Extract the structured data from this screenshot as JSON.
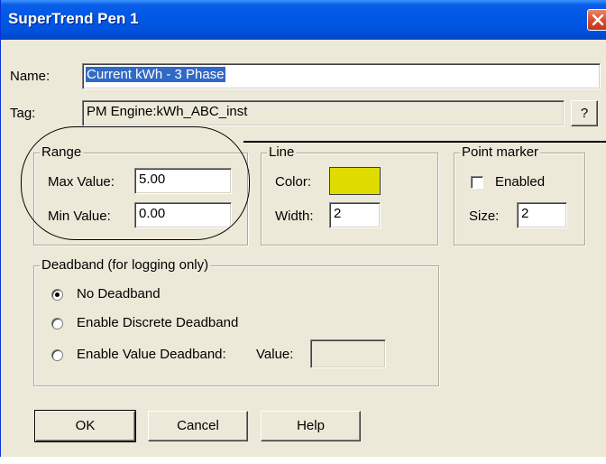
{
  "window": {
    "title": "SuperTrend Pen 1"
  },
  "name_row": {
    "label": "Name:",
    "value": "Current kWh - 3 Phase"
  },
  "tag_row": {
    "label": "Tag:",
    "value": "PM Engine:kWh_ABC_inst",
    "browse_label": "?"
  },
  "range": {
    "legend": "Range",
    "max_label": "Max Value:",
    "max_value": "5.00",
    "min_label": "Min Value:",
    "min_value": "0.00"
  },
  "line": {
    "legend": "Line",
    "color_label": "Color:",
    "color_value": "#e0dc00",
    "width_label": "Width:",
    "width_value": "2"
  },
  "point_marker": {
    "legend": "Point marker",
    "enabled_label": "Enabled",
    "enabled_checked": false,
    "size_label": "Size:",
    "size_value": "2"
  },
  "deadband": {
    "legend": "Deadband (for logging only)",
    "options": [
      {
        "label": "No Deadband",
        "selected": true
      },
      {
        "label": "Enable Discrete Deadband",
        "selected": false
      },
      {
        "label": "Enable Value Deadband:",
        "selected": false
      }
    ],
    "value_label": "Value:",
    "value": ""
  },
  "buttons": {
    "ok": "OK",
    "cancel": "Cancel",
    "help": "Help"
  },
  "colors": {
    "titlebar": "#0058e6",
    "selection": "#316ac5",
    "dialog_bg": "#ece9d8"
  }
}
